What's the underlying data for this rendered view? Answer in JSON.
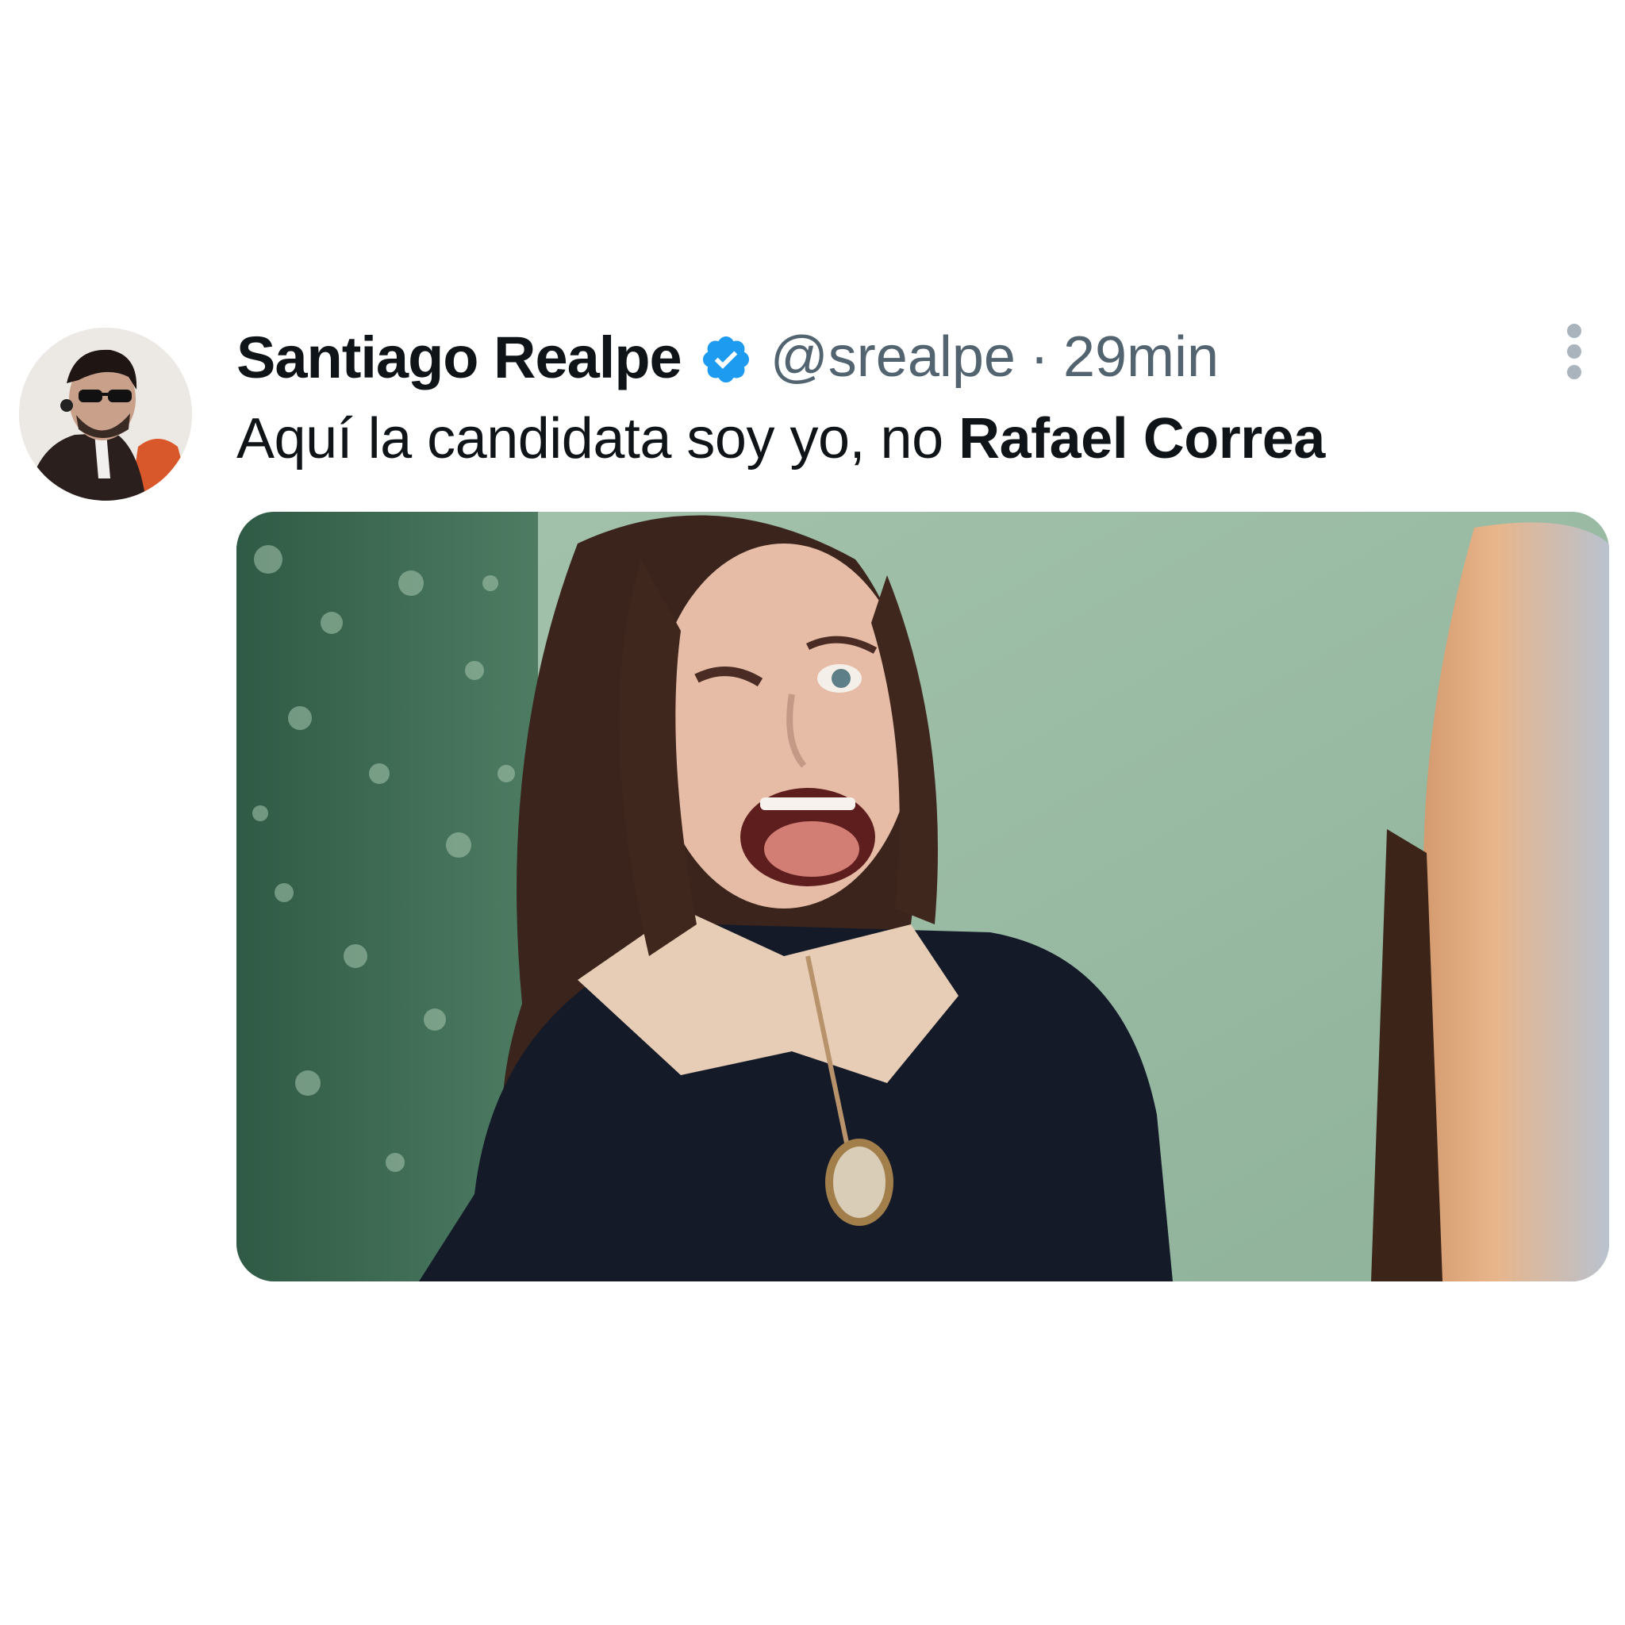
{
  "tweet": {
    "author": {
      "display_name": "Santiago Realpe",
      "verified_icon": "verified-badge-icon",
      "handle": "@srealpe",
      "avatar": "profile-avatar"
    },
    "separator": "·",
    "time": "29min",
    "text_plain": "Aquí la candidata soy yo, no ",
    "text_bold": "Rafael Correa",
    "media_description": "meme-photo-woman-winking",
    "more_icon": "more-options-icon"
  },
  "colors": {
    "text_primary": "#0f1419",
    "text_secondary": "#536471",
    "verified": "#1d9bf0",
    "background": "#ffffff"
  }
}
